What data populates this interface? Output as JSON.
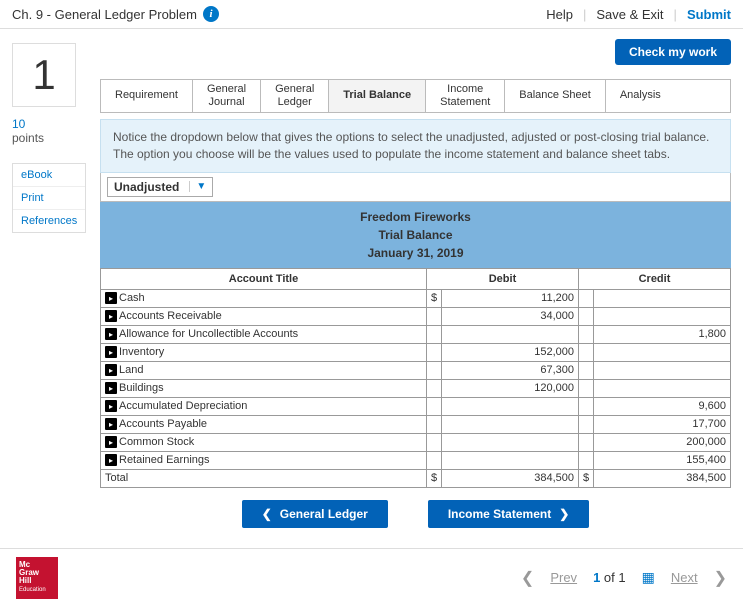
{
  "header": {
    "title": "Ch. 9 - General Ledger Problem",
    "help": "Help",
    "save_exit": "Save & Exit",
    "submit": "Submit"
  },
  "question": {
    "number": "1",
    "points_num": "10",
    "points_label": "points"
  },
  "side": {
    "ebook": "eBook",
    "print": "Print",
    "references": "References"
  },
  "check_work": "Check my work",
  "tabs": {
    "requirement": "Requirement",
    "general_journal": "General\nJournal",
    "general_ledger": "General\nLedger",
    "trial_balance": "Trial Balance",
    "income_statement": "Income\nStatement",
    "balance_sheet": "Balance Sheet",
    "analysis": "Analysis"
  },
  "notice": "Notice the dropdown below that gives the options to select the unadjusted, adjusted or post-closing trial balance. The option you choose will be the values used to populate the income statement and balance sheet tabs.",
  "dropdown": {
    "value": "Unadjusted"
  },
  "tb_header": {
    "company": "Freedom Fireworks",
    "report": "Trial Balance",
    "date": "January 31, 2019"
  },
  "columns": {
    "account": "Account Title",
    "debit": "Debit",
    "credit": "Credit"
  },
  "rows": [
    {
      "title": "Cash",
      "debit": "11,200",
      "credit": "",
      "cur_d": "$",
      "cur_c": ""
    },
    {
      "title": "Accounts Receivable",
      "debit": "34,000",
      "credit": ""
    },
    {
      "title": "Allowance for Uncollectible Accounts",
      "debit": "",
      "credit": "1,800"
    },
    {
      "title": "Inventory",
      "debit": "152,000",
      "credit": ""
    },
    {
      "title": "Land",
      "debit": "67,300",
      "credit": ""
    },
    {
      "title": "Buildings",
      "debit": "120,000",
      "credit": ""
    },
    {
      "title": "Accumulated Depreciation",
      "debit": "",
      "credit": "9,600"
    },
    {
      "title": "Accounts Payable",
      "debit": "",
      "credit": "17,700"
    },
    {
      "title": "Common Stock",
      "debit": "",
      "credit": "200,000"
    },
    {
      "title": "Retained Earnings",
      "debit": "",
      "credit": "155,400"
    }
  ],
  "total": {
    "label": "Total",
    "debit": "384,500",
    "credit": "384,500",
    "cur_d": "$",
    "cur_c": "$"
  },
  "nav": {
    "prev": "General Ledger",
    "next": "Income Statement"
  },
  "footer": {
    "logo1": "Mc",
    "logo2": "Graw",
    "logo3": "Hill",
    "logo4": "Education",
    "prev": "Prev",
    "pos": "1",
    "of": "of",
    "total": "1",
    "next": "Next"
  }
}
